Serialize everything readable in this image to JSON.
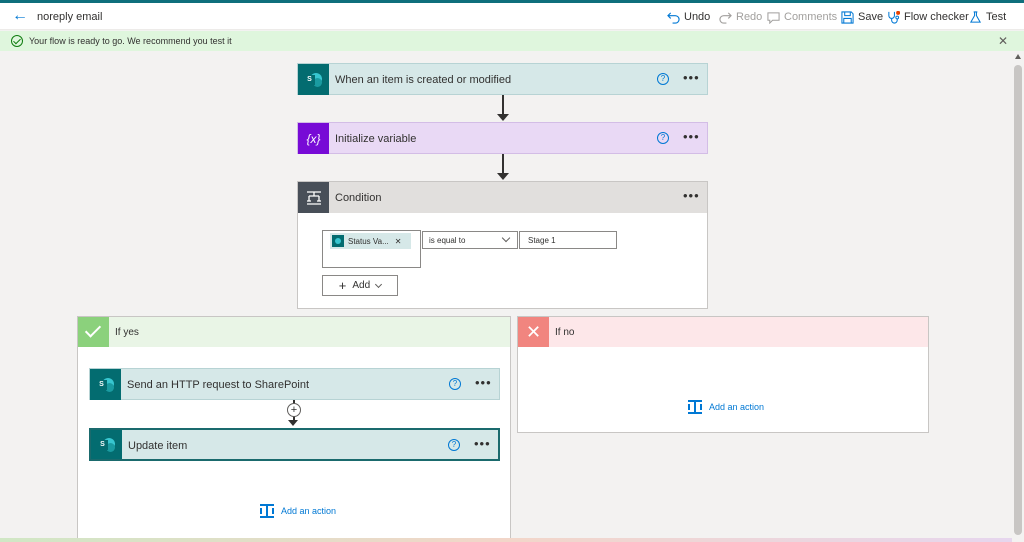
{
  "header": {
    "title": "noreply email",
    "toolbar": {
      "undo": "Undo",
      "redo": "Redo",
      "comments": "Comments",
      "save": "Save",
      "flow_checker": "Flow checker",
      "test": "Test"
    }
  },
  "banner": {
    "message": "Your flow is ready to go. We recommend you test it"
  },
  "steps": {
    "trigger": "When an item is created or modified",
    "init_variable": "Initialize variable",
    "init_variable_icon": "{x}",
    "condition": "Condition"
  },
  "condition": {
    "token_label": "Status Va...",
    "operator": "is equal to",
    "value": "Stage 1",
    "add_label": "Add"
  },
  "branches": {
    "yes": {
      "title": "If yes",
      "actions": [
        "Send an HTTP request to SharePoint",
        "Update item"
      ],
      "add_action": "Add an action"
    },
    "no": {
      "title": "If no",
      "add_action": "Add an action"
    }
  },
  "colors": {
    "accent": "#0078d4",
    "sharepoint_header": "#d6e8e8",
    "variable_header": "#e9d9f5",
    "condition_header": "#e1dfdd",
    "yes_header": "#e9f5e6",
    "no_header": "#fde7e9"
  }
}
